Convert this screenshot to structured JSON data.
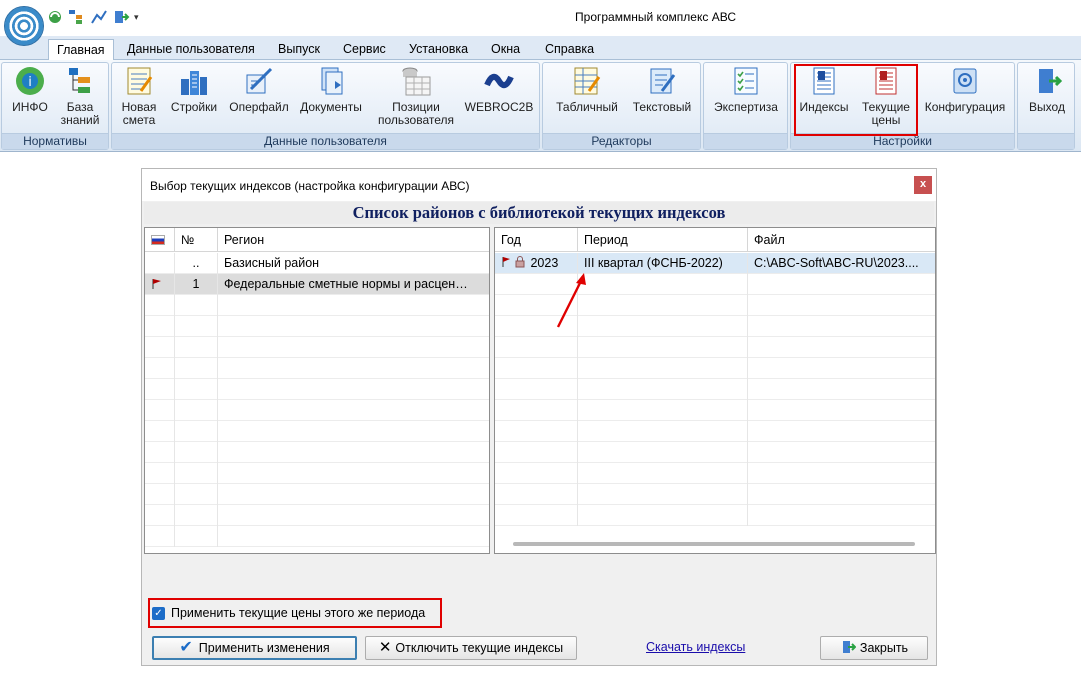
{
  "window": {
    "title": "Программный комплекс АВС"
  },
  "tabs": [
    "Главная",
    "Данные пользователя",
    "Выпуск",
    "Сервис",
    "Установка",
    "Окна",
    "Справка"
  ],
  "ribbon": {
    "groups": {
      "normativy": "Нормативы",
      "user_data": "Данные пользователя",
      "editors": "Редакторы",
      "settings": "Настройки"
    },
    "buttons": {
      "info": "ИНФО",
      "kb1": "База",
      "kb2": "знаний",
      "new1": "Новая",
      "new2": "смета",
      "stroyki": "Стройки",
      "operfile": "Оперфайл",
      "documents": "Документы",
      "pos1": "Позиции",
      "pos2": "пользователя",
      "webroc": "WEBROC2B",
      "tabular": "Табличный",
      "text": "Текстовый",
      "expertise": "Экспертиза",
      "indices": "Индексы",
      "prices1": "Текущие",
      "prices2": "цены",
      "config": "Конфигурация",
      "exit": "Выход"
    }
  },
  "dialog": {
    "title": "Выбор текущих индексов (настройка конфигурации АВС)",
    "close": "x",
    "header": "Список районов с библиотекой текущих индексов",
    "left_grid": {
      "col_no": "№",
      "col_region": "Регион",
      "rows": [
        {
          "no": "..",
          "region": "Базисный район"
        },
        {
          "no": "1",
          "region": "Федеральные сметные нормы и расцен…"
        }
      ]
    },
    "right_grid": {
      "col_year": "Год",
      "col_period": "Период",
      "col_file": "Файл",
      "rows": [
        {
          "year": "2023",
          "period": "III квартал (ФСНБ-2022)",
          "file": "C:\\ABC-Soft\\ABC-RU\\2023...."
        }
      ]
    },
    "checkbox_label": "Применить текущие цены этого же периода",
    "checkbox_checked": true,
    "apply_button": "Применить изменения",
    "disable_button": "Отключить текущие индексы",
    "download_link": "Скачать индексы",
    "close_button": "Закрыть"
  }
}
